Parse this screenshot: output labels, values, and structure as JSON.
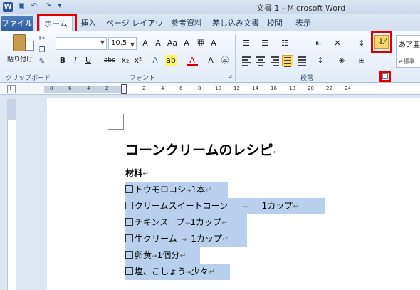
{
  "window": {
    "title": "文書 1 - Microsoft Word",
    "app_icon": "W"
  },
  "quick_access": [
    "save-icon",
    "undo-icon",
    "redo-icon"
  ],
  "tabs": [
    {
      "label": "ファイル"
    },
    {
      "label": "ホーム"
    },
    {
      "label": "挿入"
    },
    {
      "label": "ページ レイアウト"
    },
    {
      "label": "参考資料"
    },
    {
      "label": "差し込み文書"
    },
    {
      "label": "校閲"
    },
    {
      "label": "表示"
    }
  ],
  "ribbon": {
    "clipboard": {
      "paste_label": "貼り付け",
      "group_label": "クリップボード"
    },
    "font": {
      "font_size": "10.5",
      "group_label": "フォント",
      "format_buttons": [
        "B",
        "I",
        "U",
        "abc",
        "x₂",
        "x²"
      ]
    },
    "paragraph": {
      "group_label": "段落",
      "sort_label": "↓⁄"
    },
    "styles": {
      "sample": "あア亜",
      "sub": "↵標準"
    }
  },
  "ruler": {
    "ticks": [
      "8",
      "6",
      "4",
      "2",
      "",
      "2",
      "4",
      "6",
      "8",
      "10",
      "12",
      "14",
      "16",
      "18",
      "20",
      "22",
      "24"
    ],
    "corner": "L"
  },
  "document": {
    "title": "コーンクリームのレシピ",
    "heading": "材料",
    "ingredients": [
      {
        "name": "トウモロコシ",
        "amount": "1本"
      },
      {
        "name": "クリームスイートコーン",
        "amount": "1カップ"
      },
      {
        "name": "チキンスープ",
        "amount": "1カップ"
      },
      {
        "name": "生クリーム",
        "amount": "1カップ"
      },
      {
        "name": "卵黄",
        "amount": "1個分"
      },
      {
        "name": "塩、こしょう",
        "amount": "少々"
      }
    ]
  }
}
